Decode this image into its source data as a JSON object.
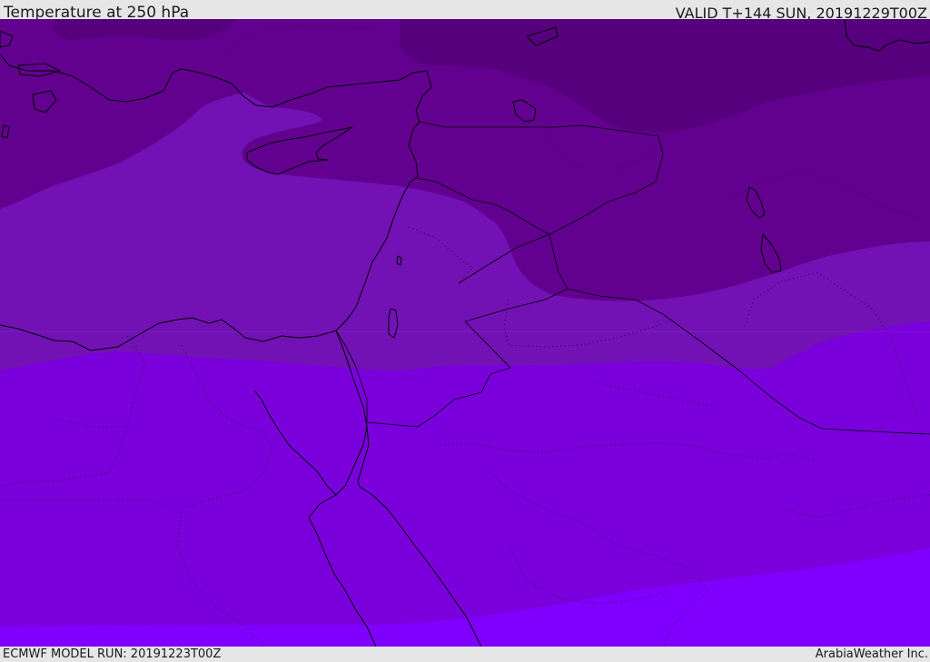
{
  "header": {
    "title": "Temperature at 250 hPa",
    "valid": "VALID T+144 SUN, 20191229T00Z"
  },
  "footer": {
    "model_run": "ECMWF MODEL RUN: 20191223T00Z",
    "provider": "ArabiaWeather Inc."
  },
  "map": {
    "variable": "temperature",
    "level": "250 hPa",
    "region": "Eastern Mediterranean / Middle East",
    "shading_colors": {
      "coldest": "#56007e",
      "colder": "#62008f",
      "cold": "#7212b4",
      "mid": "#7a00dc",
      "warm": "#8000ff"
    }
  }
}
